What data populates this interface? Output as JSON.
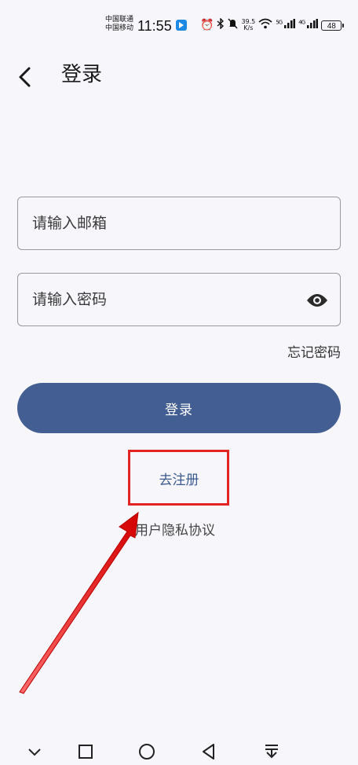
{
  "status_bar": {
    "carrier_1": "中国联通",
    "carrier_2": "中国移动",
    "time": "11:55",
    "net_speed_value": "39.5",
    "net_speed_unit": "K/s",
    "signal_1_label": "5G",
    "signal_2_label": "4G",
    "battery": "48"
  },
  "header": {
    "title": "登录"
  },
  "form": {
    "email_placeholder": "请输入邮箱",
    "email_value": "",
    "password_placeholder": "请输入密码",
    "password_value": "",
    "forgot_password": "忘记密码",
    "login_label": "登录",
    "register_label": "去注册",
    "privacy_label": "用户隐私协议"
  },
  "colors": {
    "background": "#f7f6fb",
    "primary": "#425e92",
    "link": "#3c5a8e",
    "annotation": "#e32424"
  },
  "icons": {
    "back": "chevron-left-icon",
    "visibility": "eye-icon",
    "nav_collapse": "chevron-down-icon",
    "nav_recents": "square-icon",
    "nav_home": "circle-icon",
    "nav_back": "triangle-left-icon",
    "nav_notifications": "pull-down-icon"
  }
}
